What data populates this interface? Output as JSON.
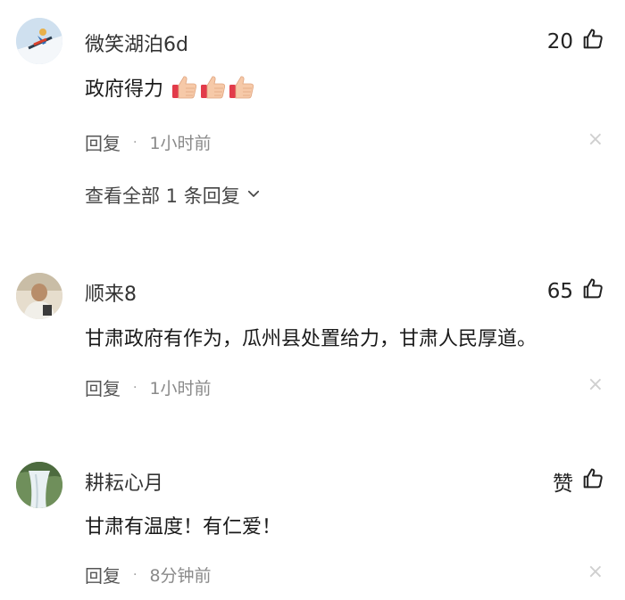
{
  "comments": [
    {
      "username": "微笑湖泊6d",
      "like_count": "20",
      "content": "政府得力",
      "emoji_count": 3,
      "reply_label": "回复",
      "separator": "·",
      "time": "1小时前",
      "close_symbol": "×",
      "view_all_text": "查看全部 1 条回复"
    },
    {
      "username": "顺来8",
      "like_count": "65",
      "content": "甘肃政府有作为，瓜州县处置给力，甘肃人民厚道。",
      "reply_label": "回复",
      "separator": "·",
      "time": "1小时前",
      "close_symbol": "×"
    },
    {
      "username": "耕耘心月",
      "like_count": "赞",
      "content": "甘肃有温度！有仁爱！",
      "reply_label": "回复",
      "separator": "·",
      "time": "8分钟前",
      "close_symbol": "×"
    }
  ],
  "icons": {
    "like": "thumbs-up-outline-icon",
    "emoji": "thumbs-up-emoji-icon",
    "chevron": "chevron-down-icon",
    "close": "close-icon"
  },
  "colors": {
    "meta_text": "#8a8a8a",
    "close": "#cfcfcf"
  }
}
